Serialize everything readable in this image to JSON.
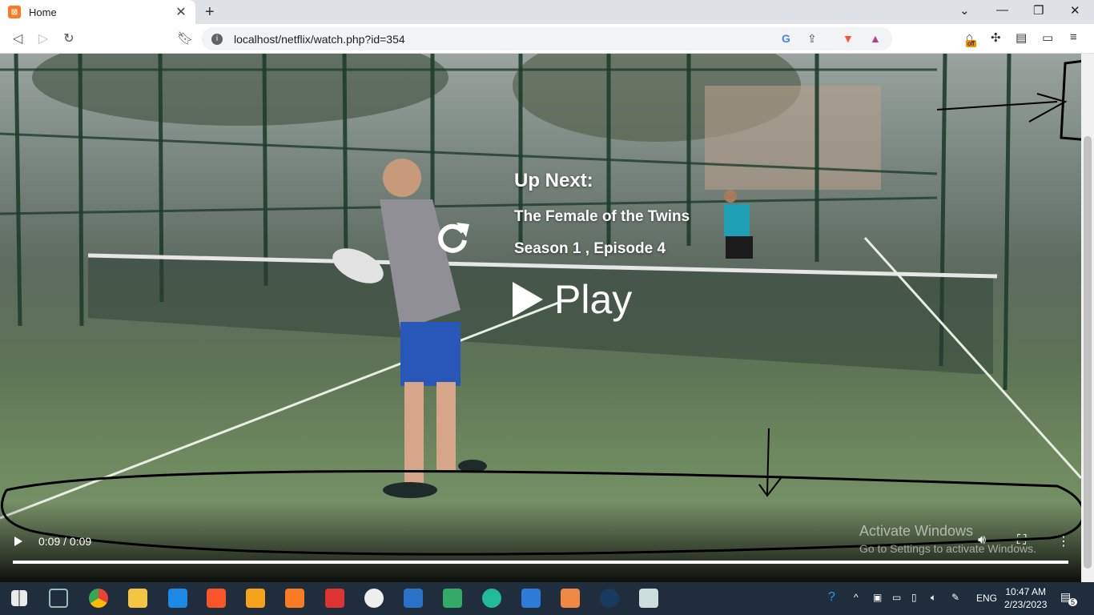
{
  "browser": {
    "tab_title": "Home",
    "url": "localhost/netflix/watch.php?id=354",
    "extension_badge": "off"
  },
  "player": {
    "up_next_label": "Up Next:",
    "next_title": "The Female of the Twins",
    "next_episode": "Season 1 , Episode 4",
    "play_label": "Play",
    "time_display": "0:09 / 0:09",
    "progress_fraction": 1.0
  },
  "watermark": {
    "line1": "Activate Windows",
    "line2": "Go to Settings to activate Windows."
  },
  "taskbar": {
    "language": "ENG",
    "time": "10:47 AM",
    "date": "2/23/2023",
    "notification_count": "5"
  }
}
